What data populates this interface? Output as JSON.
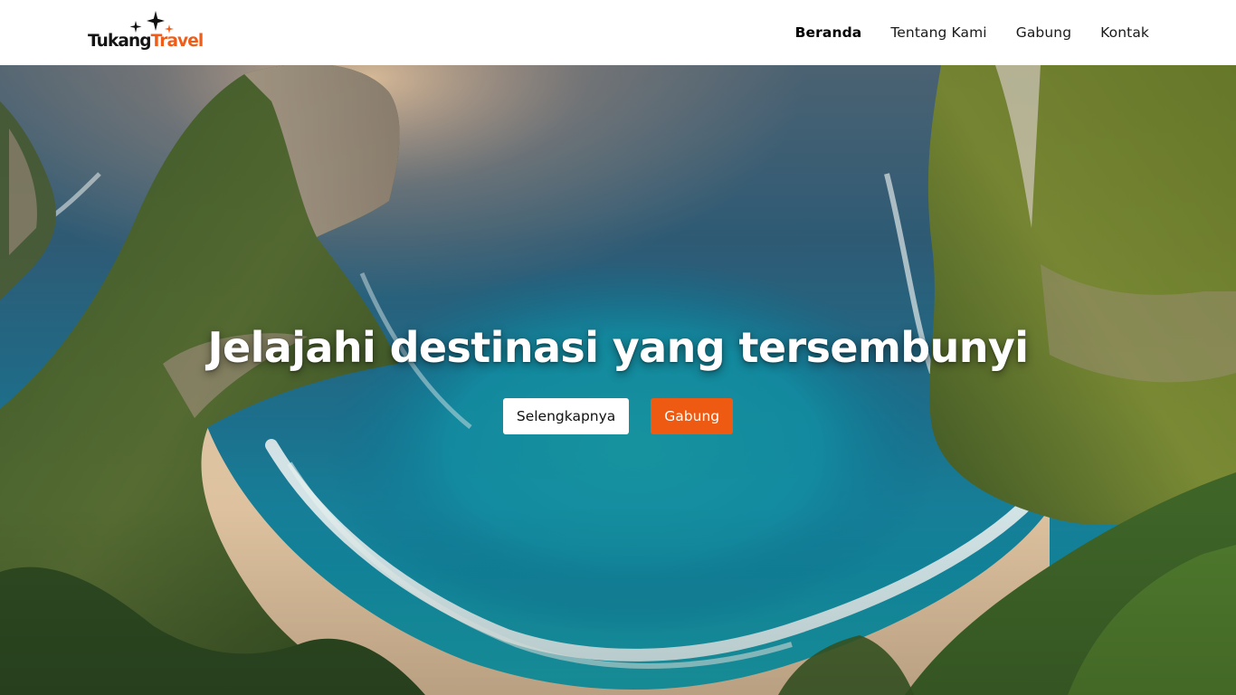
{
  "brand": {
    "name_part1": "Tukang",
    "name_part2": "Travel",
    "accent_color": "#ef5d19",
    "logo_icon": "sparkle-stars-icon"
  },
  "nav": {
    "items": [
      {
        "label": "Beranda",
        "active": true
      },
      {
        "label": "Tentang Kami",
        "active": false
      },
      {
        "label": "Gabung",
        "active": false
      },
      {
        "label": "Kontak",
        "active": false
      }
    ]
  },
  "hero": {
    "title": "Jelajahi destinasi yang tersembunyi",
    "primary_button": "Selengkapnya",
    "secondary_button": "Gabung",
    "button_accent_color": "#ef5a13"
  }
}
